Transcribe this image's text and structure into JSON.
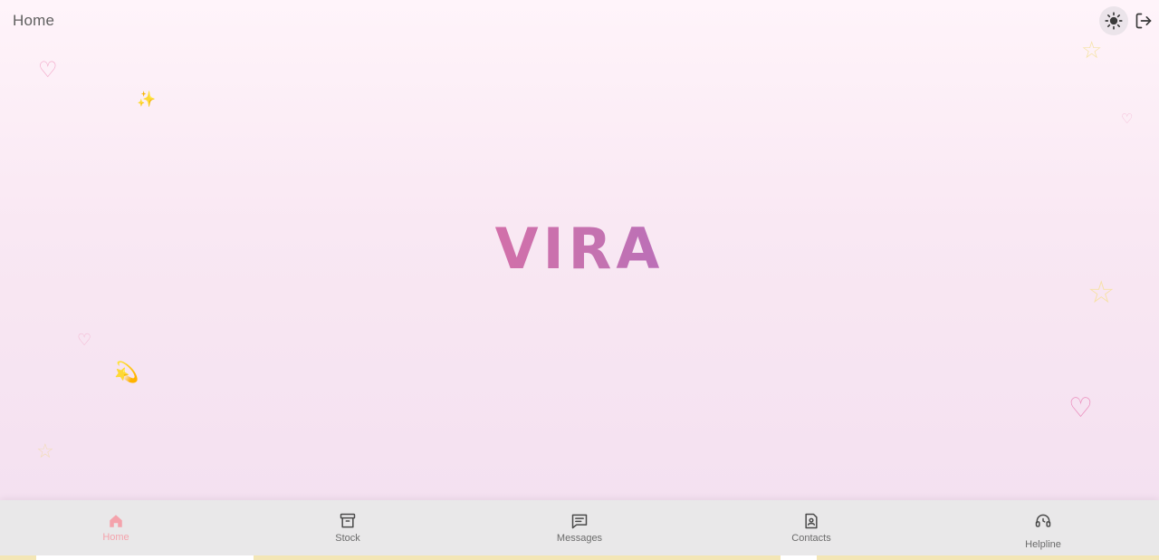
{
  "header": {
    "title": "Home",
    "theme_toggle_icon": "sun-icon",
    "logout_icon": "logout-icon"
  },
  "brand": {
    "name": "VIRA",
    "gradient_colors": [
      "#df6ea3",
      "#ad6cc4"
    ]
  },
  "decorations": {
    "items": [
      {
        "icon": "heart-outline-icon",
        "glyph": "♡",
        "color": "#f2a6c8"
      },
      {
        "icon": "sparkles-icon",
        "glyph": "✨",
        "color": "#f5c542"
      },
      {
        "icon": "star-outline-icon",
        "glyph": "☆",
        "color": "#f6e3a6"
      },
      {
        "icon": "heart-outline-icon",
        "glyph": "♡",
        "color": "#f4b7d2"
      },
      {
        "icon": "heart-outline-icon",
        "glyph": "♡",
        "color": "#f4b7d2"
      },
      {
        "icon": "dizzy-star-icon",
        "glyph": "💫",
        "color": "#f5c542"
      },
      {
        "icon": "star-outline-icon",
        "glyph": "☆",
        "color": "#f7e1a8"
      },
      {
        "icon": "heart-outline-icon",
        "glyph": "♡",
        "color": "#ec8fbe"
      },
      {
        "icon": "star-outline-icon",
        "glyph": "☆",
        "color": "#f3dcb8"
      }
    ]
  },
  "bottom_nav": {
    "items": [
      {
        "label": "Home",
        "icon": "home-icon",
        "active": true
      },
      {
        "label": "Stock",
        "icon": "archive-box-icon",
        "active": false
      },
      {
        "label": "Messages",
        "icon": "message-square-icon",
        "active": false
      },
      {
        "label": "Contacts",
        "icon": "contact-file-icon",
        "active": false
      },
      {
        "label": "Helpline",
        "icon": "headset-icon",
        "active": false
      }
    ]
  },
  "colors": {
    "active_nav": "#f4a3ac",
    "inactive_nav": "#6b6b6b",
    "nav_background": "#e9e8e9"
  }
}
